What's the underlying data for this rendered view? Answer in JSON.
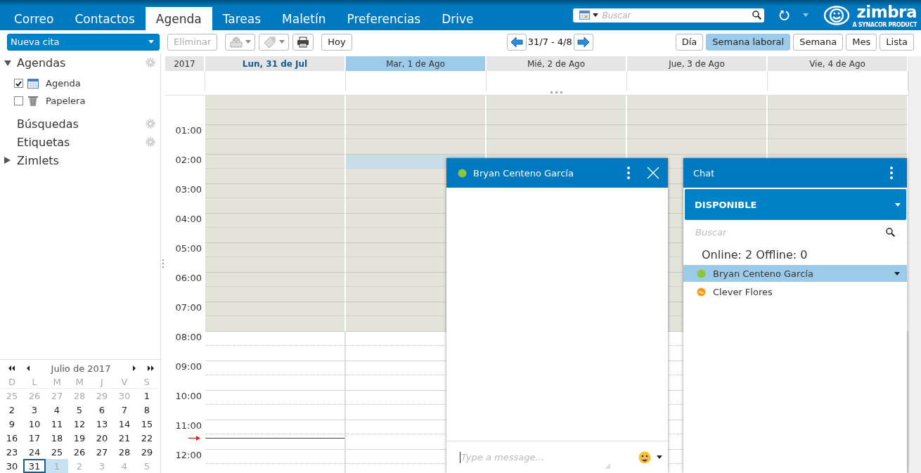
{
  "top_bar": {
    "tabs": [
      {
        "label": "Correo",
        "selected": false
      },
      {
        "label": "Contactos",
        "selected": false
      },
      {
        "label": "Agenda",
        "selected": true
      },
      {
        "label": "Tareas",
        "selected": false
      },
      {
        "label": "Maletín",
        "selected": false
      },
      {
        "label": "Preferencias",
        "selected": false
      },
      {
        "label": "Drive",
        "selected": false
      }
    ],
    "search": {
      "placeholder": "Buscar"
    },
    "logo": {
      "name": "zimbra",
      "tagline": "A SYNACOR PRODUCT"
    }
  },
  "toolbar": {
    "new_button": "Nueva cita",
    "delete_button": {
      "label": "Eliminar",
      "disabled": true
    },
    "today_button": "Hoy",
    "date_range": "31/7 - 4/8",
    "views": [
      {
        "label": "Día",
        "selected": false
      },
      {
        "label": "Semana laboral",
        "selected": true
      },
      {
        "label": "Semana",
        "selected": false
      },
      {
        "label": "Mes",
        "selected": false
      },
      {
        "label": "Lista",
        "selected": false
      }
    ]
  },
  "sidebar": {
    "sections": [
      {
        "kind": "tree",
        "label": "Agendas",
        "expanded": true,
        "settings": true,
        "calendars": [
          {
            "kind": "calendar",
            "label": "Agenda",
            "checked": true
          },
          {
            "kind": "trash",
            "label": "Papelera",
            "checked": false
          }
        ]
      },
      {
        "kind": "heading",
        "label": "Búsquedas",
        "settings": true
      },
      {
        "kind": "heading",
        "label": "Etiquetas",
        "settings": true
      },
      {
        "kind": "tree",
        "label": "Zimlets",
        "expanded": false,
        "settings": false
      }
    ]
  },
  "mini_calendar": {
    "title": "Julio de 2017",
    "weekdays": [
      "D",
      "L",
      "M",
      "M",
      "J",
      "V",
      "S"
    ],
    "days": [
      {
        "text": "25",
        "muted": true,
        "today": false,
        "selected": false
      },
      {
        "text": "26",
        "muted": true,
        "today": false,
        "selected": false
      },
      {
        "text": "27",
        "muted": true,
        "today": false,
        "selected": false
      },
      {
        "text": "28",
        "muted": true,
        "today": false,
        "selected": false
      },
      {
        "text": "29",
        "muted": true,
        "today": false,
        "selected": false
      },
      {
        "text": "30",
        "muted": true,
        "today": false,
        "selected": false
      },
      {
        "text": "1",
        "muted": false,
        "today": false,
        "selected": false
      },
      {
        "text": "2",
        "muted": false,
        "today": false,
        "selected": false
      },
      {
        "text": "3",
        "muted": false,
        "today": false,
        "selected": false
      },
      {
        "text": "4",
        "muted": false,
        "today": false,
        "selected": false
      },
      {
        "text": "5",
        "muted": false,
        "today": false,
        "selected": false
      },
      {
        "text": "6",
        "muted": false,
        "today": false,
        "selected": false
      },
      {
        "text": "7",
        "muted": false,
        "today": false,
        "selected": false
      },
      {
        "text": "8",
        "muted": false,
        "today": false,
        "selected": false
      },
      {
        "text": "9",
        "muted": false,
        "today": false,
        "selected": false
      },
      {
        "text": "10",
        "muted": false,
        "today": false,
        "selected": false
      },
      {
        "text": "11",
        "muted": false,
        "today": false,
        "selected": false
      },
      {
        "text": "12",
        "muted": false,
        "today": false,
        "selected": false
      },
      {
        "text": "13",
        "muted": false,
        "today": false,
        "selected": false
      },
      {
        "text": "14",
        "muted": false,
        "today": false,
        "selected": false
      },
      {
        "text": "15",
        "muted": false,
        "today": false,
        "selected": false
      },
      {
        "text": "16",
        "muted": false,
        "today": false,
        "selected": false
      },
      {
        "text": "17",
        "muted": false,
        "today": false,
        "selected": false
      },
      {
        "text": "18",
        "muted": false,
        "today": false,
        "selected": false
      },
      {
        "text": "19",
        "muted": false,
        "today": false,
        "selected": false
      },
      {
        "text": "20",
        "muted": false,
        "today": false,
        "selected": false
      },
      {
        "text": "21",
        "muted": false,
        "today": false,
        "selected": false
      },
      {
        "text": "22",
        "muted": false,
        "today": false,
        "selected": false
      },
      {
        "text": "23",
        "muted": false,
        "today": false,
        "selected": false
      },
      {
        "text": "24",
        "muted": false,
        "today": false,
        "selected": false
      },
      {
        "text": "25",
        "muted": false,
        "today": false,
        "selected": false
      },
      {
        "text": "26",
        "muted": false,
        "today": false,
        "selected": false
      },
      {
        "text": "27",
        "muted": false,
        "today": false,
        "selected": false
      },
      {
        "text": "28",
        "muted": false,
        "today": false,
        "selected": false
      },
      {
        "text": "29",
        "muted": false,
        "today": false,
        "selected": false
      },
      {
        "text": "30",
        "muted": false,
        "today": false,
        "selected": false
      },
      {
        "text": "31",
        "muted": false,
        "today": true,
        "selected": false
      },
      {
        "text": "1",
        "muted": true,
        "today": false,
        "selected": true
      },
      {
        "text": "2",
        "muted": true,
        "today": false,
        "selected": false
      },
      {
        "text": "3",
        "muted": true,
        "today": false,
        "selected": false
      },
      {
        "text": "4",
        "muted": true,
        "today": false,
        "selected": false
      },
      {
        "text": "5",
        "muted": true,
        "today": false,
        "selected": false
      }
    ]
  },
  "calendar": {
    "year": "2017",
    "days": [
      {
        "label": "Lun, 31 de Jul",
        "today": true,
        "selected": false
      },
      {
        "label": "Mar, 1 de Ago",
        "today": false,
        "selected": true
      },
      {
        "label": "Mié, 2 de Ago",
        "today": false,
        "selected": false
      },
      {
        "label": "Jue, 3 de Ago",
        "today": false,
        "selected": false
      },
      {
        "label": "Vie, 4 de Ago",
        "today": false,
        "selected": false
      }
    ],
    "hours": [
      {
        "working": false,
        "highlighted": false
      },
      {
        "label": "01:00",
        "working": false,
        "highlighted": false
      },
      {
        "label": "02:00",
        "working": false,
        "highlighted": true
      },
      {
        "label": "03:00",
        "working": false,
        "highlighted": false
      },
      {
        "label": "04:00",
        "working": false,
        "highlighted": false
      },
      {
        "label": "05:00",
        "working": false,
        "highlighted": false
      },
      {
        "label": "06:00",
        "working": false,
        "highlighted": false
      },
      {
        "label": "07:00",
        "working": false,
        "highlighted": false
      },
      {
        "label": "08:00",
        "working": true,
        "highlighted": false
      },
      {
        "label": "09:00",
        "working": true,
        "highlighted": false
      },
      {
        "label": "10:00",
        "working": true,
        "highlighted": false
      },
      {
        "label": "11:00",
        "working": true,
        "highlighted": false
      },
      {
        "label": "12:00",
        "working": true,
        "highlighted": false
      }
    ]
  },
  "chat_window": {
    "contact": "Bryan Centeno García",
    "kind": "online",
    "placeholder": "Type a message..."
  },
  "chat_panel": {
    "title": "Chat",
    "status": "DISPONIBLE",
    "search_placeholder": "Buscar",
    "summary": "Online: 2 Offline: 0",
    "contacts": [
      {
        "name": "Bryan Centeno García",
        "kind": "online",
        "color": "#8cc63f",
        "selected": true
      },
      {
        "name": "Clever Flores",
        "kind": "away",
        "color": "#f39c1f",
        "selected": false
      }
    ]
  }
}
